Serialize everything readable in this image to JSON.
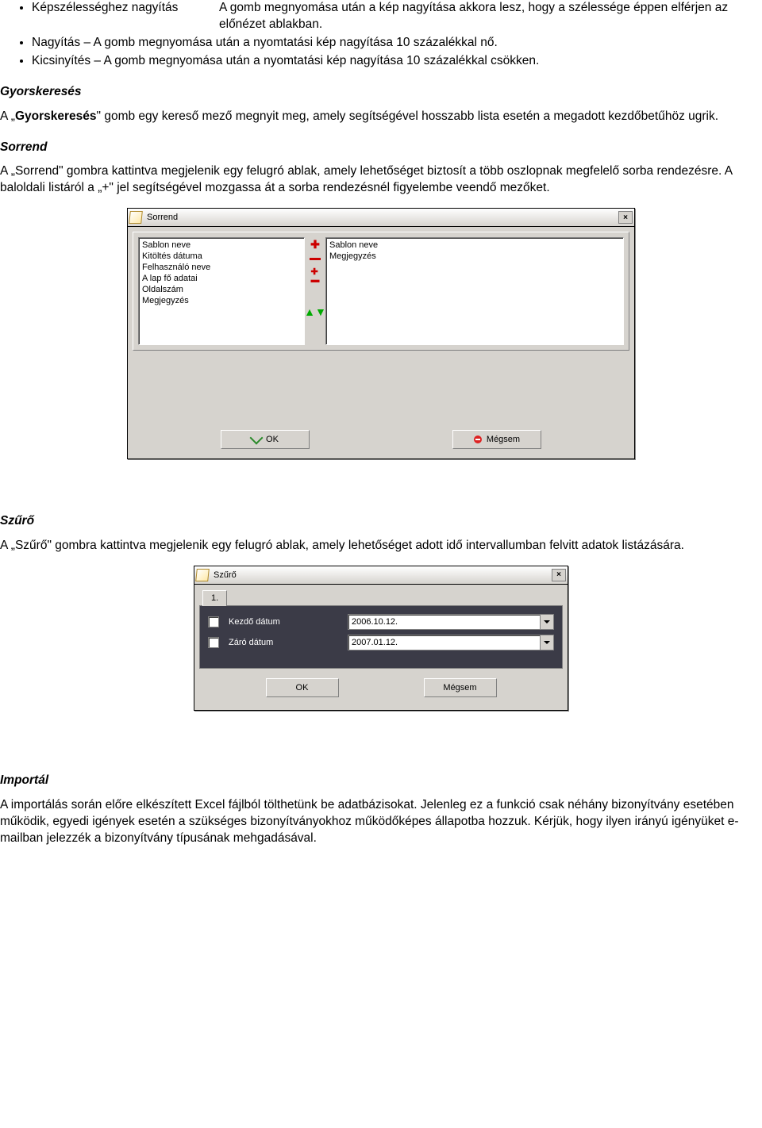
{
  "bullets": {
    "b1_label": "Képszélességhez nagyítás",
    "b1_desc": "A gomb megnyomása után a kép nagyítása akkora lesz, hogy a szélessége éppen elférjen az előnézet ablakban.",
    "b2": "Nagyítás – A gomb megnyomása után a nyomtatási kép nagyítása 10 százalékkal nő.",
    "b3": "Kicsinyítés – A gomb megnyomása után a nyomtatási kép nagyítása 10 százalékkal csökken."
  },
  "gyorskereses": {
    "heading": "Gyorskeresés",
    "p_a": "A „",
    "p_bold": "Gyorskeresés",
    "p_b": "\" gomb egy kereső mező megnyit meg, amely segítségével hosszabb lista esetén a megadott kezdőbetűhöz ugrik."
  },
  "sorrend": {
    "heading": "Sorrend",
    "p": "A „Sorrend\" gombra kattintva megjelenik egy felugró ablak, amely lehetőséget biztosít a több oszlopnak megfelelő sorba rendezésre. A baloldali listáról a „+\" jel segítségével mozgassa át a sorba rendezésnél figyelembe veendő mezőket.",
    "dialog": {
      "title": "Sorrend",
      "left_list": [
        "Sablon neve",
        "Kitöltés dátuma",
        "Felhasználó neve",
        "A lap fő adatai",
        "Oldalszám",
        "Megjegyzés"
      ],
      "right_list": [
        "Sablon neve",
        "Megjegyzés"
      ],
      "ok": "OK",
      "cancel": "Mégsem"
    }
  },
  "szuro": {
    "heading": "Szűrő",
    "p": "A „Szűrő\" gombra kattintva megjelenik egy felugró ablak, amely lehetőséget adott idő intervallumban felvitt adatok listázására.",
    "dialog": {
      "title": "Szűrő",
      "tab": "1.",
      "row1_label": "Kezdő dátum",
      "row1_value": "2006.10.12.",
      "row2_label": "Záró dátum",
      "row2_value": "2007.01.12.",
      "ok": "OK",
      "cancel": "Mégsem"
    }
  },
  "importal": {
    "heading": "Importál",
    "p": "A importálás során előre elkészített Excel fájlból tölthetünk be adatbázisokat. Jelenleg ez a funkció csak néhány bizonyítvány esetében működik, egyedi igények esetén a szükséges bizonyítványokhoz működőképes állapotba hozzuk. Kérjük, hogy ilyen irányú igényüket e-mailban jelezzék a bizonyítvány típusának mehgadásával."
  }
}
